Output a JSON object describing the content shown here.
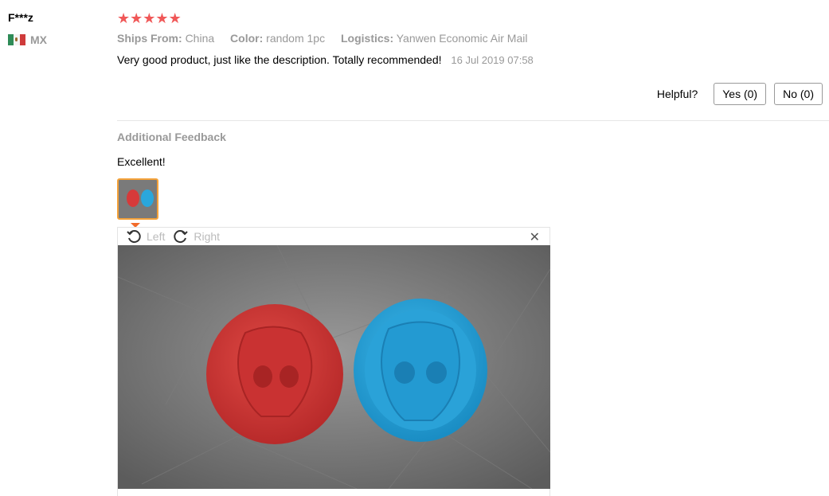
{
  "reviewer": {
    "name": "F***z",
    "country_code": "MX"
  },
  "rating": {
    "stars": 5,
    "max": 5
  },
  "meta": {
    "ships_from_label": "Ships From:",
    "ships_from_value": "China",
    "color_label": "Color:",
    "color_value": "random 1pc",
    "logistics_label": "Logistics:",
    "logistics_value": "Yanwen Economic Air Mail"
  },
  "review": {
    "text": "Very good product, just like the description. Totally recommended!",
    "date": "16 Jul 2019 07:58"
  },
  "helpful": {
    "label": "Helpful?",
    "yes_label": "Yes (0)",
    "no_label": "No (0)"
  },
  "additional": {
    "title": "Additional Feedback",
    "text": "Excellent!"
  },
  "viewer": {
    "rotate_left_label": "Left",
    "rotate_right_label": "Right",
    "close_glyph": "✕"
  },
  "colors": {
    "star": "#f05858",
    "thumb_border": "#f4a23a",
    "pointer": "#f26b2a",
    "red_mold": "#d63a3a",
    "blue_mold": "#2aa7dc"
  }
}
